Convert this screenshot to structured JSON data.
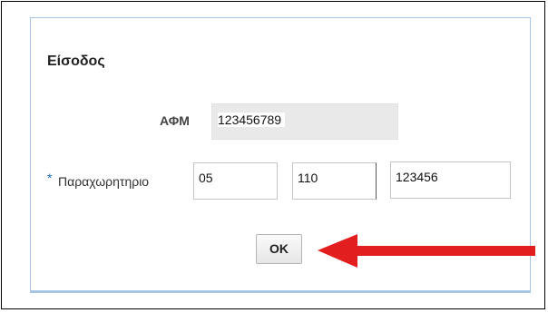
{
  "dialog": {
    "title": "Είσοδος",
    "afm": {
      "label": "ΑΦΜ",
      "value": "123456789"
    },
    "paraxoritirio": {
      "required_marker": "*",
      "label": "Παραχωρητηριο",
      "values": [
        "05",
        "110",
        "123456"
      ]
    },
    "ok_label": "OK"
  },
  "colors": {
    "arrow": "#e31e1e",
    "dialog_border": "#a7c4e6",
    "required_star": "#1a69c9"
  },
  "annotation": {
    "icon": "red-arrow-icon"
  }
}
